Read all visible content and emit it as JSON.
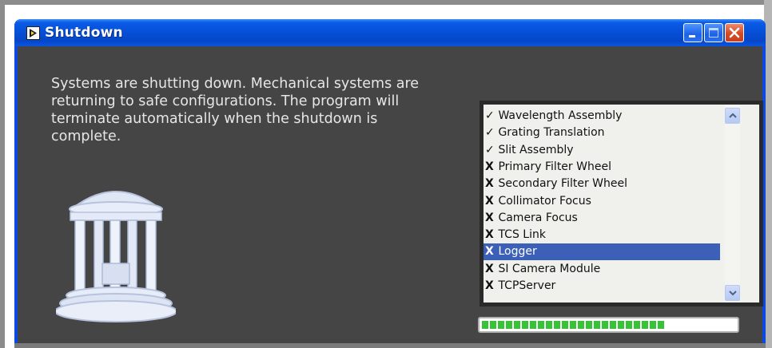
{
  "window": {
    "title": "Shutdown",
    "controls": [
      "minimize-icon",
      "maximize-icon",
      "close-icon"
    ]
  },
  "message": "Systems are shutting down.  Mechanical systems are\nreturning to safe configurations. The program will\nterminate automatically when the shutdown is\ncomplete.",
  "subsystems": [
    {
      "mark": "✓",
      "label": "Wavelength Assembly",
      "selected": false
    },
    {
      "mark": "✓",
      "label": "Grating Translation",
      "selected": false
    },
    {
      "mark": "✓",
      "label": "Slit Assembly",
      "selected": false
    },
    {
      "mark": "X",
      "label": "Primary Filter Wheel",
      "selected": false
    },
    {
      "mark": "X",
      "label": "Secondary Filter Wheel",
      "selected": false
    },
    {
      "mark": "X",
      "label": "Collimator Focus",
      "selected": false
    },
    {
      "mark": "X",
      "label": "Camera Focus",
      "selected": false
    },
    {
      "mark": "X",
      "label": "TCS Link",
      "selected": false
    },
    {
      "mark": "X",
      "label": "Logger",
      "selected": true
    },
    {
      "mark": "X",
      "label": "SI Camera Module",
      "selected": false
    },
    {
      "mark": "X",
      "label": "TCPServer",
      "selected": false
    }
  ],
  "progress": {
    "fraction": 0.74,
    "color": "#38c238"
  },
  "colors": {
    "titlebar": "#0650d8",
    "client_bg": "#454545",
    "selection": "#3c5fb8"
  }
}
